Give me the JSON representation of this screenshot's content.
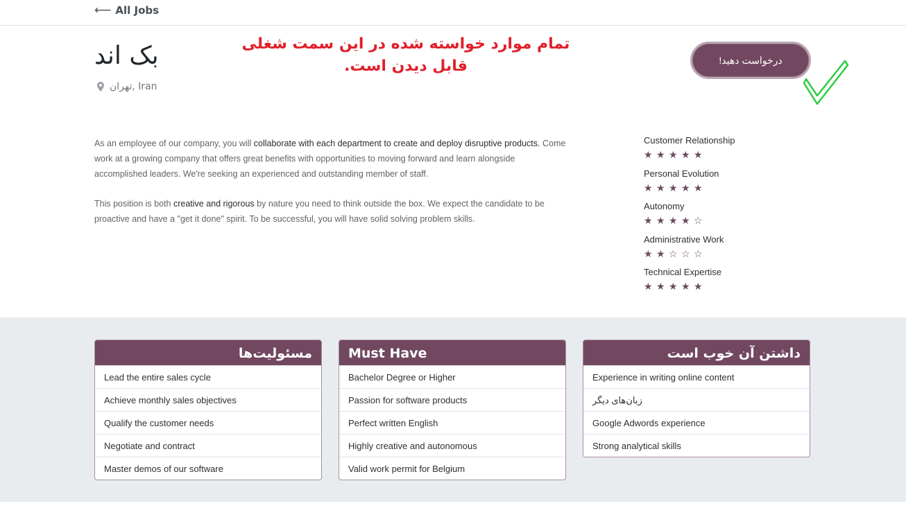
{
  "nav": {
    "back_label": "All Jobs"
  },
  "job": {
    "title": "بک اند",
    "location": "تهران, Iran"
  },
  "annotation": "تمام موارد خواسته شده در این سمت شغلی قابل دیدن است.",
  "apply_button": "درخواست دهید!",
  "description": {
    "p1": [
      {
        "text": "As an employee of our company, you will ",
        "bold": false
      },
      {
        "text": "collaborate with each department to create and deploy disruptive products.",
        "bold": true
      },
      {
        "text": " Come work at a growing company that offers great benefits with opportunities to moving forward and learn alongside accomplished leaders. We're seeking an experienced and outstanding member of staff.",
        "bold": false
      }
    ],
    "p2": [
      {
        "text": "This position is both ",
        "bold": false
      },
      {
        "text": "creative and rigorous",
        "bold": true
      },
      {
        "text": " by nature you need to think outside the box. We expect the candidate to be proactive and have a \"get it done\" spirit. To be successful, you will have solid solving problem skills.",
        "bold": false
      }
    ]
  },
  "ratings": [
    {
      "label": "Customer Relationship",
      "stars": 5,
      "max": 5
    },
    {
      "label": "Personal Evolution",
      "stars": 5,
      "max": 5
    },
    {
      "label": "Autonomy",
      "stars": 4,
      "max": 5
    },
    {
      "label": "Administrative Work",
      "stars": 2,
      "max": 5
    },
    {
      "label": "Technical Expertise",
      "stars": 5,
      "max": 5
    }
  ],
  "cards": [
    {
      "title": "مسئولیت‌ها",
      "rtl": true,
      "items": [
        "Lead the entire sales cycle",
        "Achieve monthly sales objectives",
        "Qualify the customer needs",
        "Negotiate and contract",
        "Master demos of our software"
      ]
    },
    {
      "title": "Must Have",
      "rtl": false,
      "items": [
        "Bachelor Degree or Higher",
        "Passion for software products",
        "Perfect written English",
        "Highly creative and autonomous",
        "Valid work permit for Belgium"
      ]
    },
    {
      "title": "داشتن آن خوب است",
      "rtl": true,
      "items": [
        "Experience in writing online content",
        "زبان‌های دیگر",
        "Google Adwords experience",
        "Strong analytical skills"
      ]
    }
  ],
  "colors": {
    "brand": "#71485f",
    "annotation": "#e0202a",
    "check": "#2ecc40"
  },
  "icons": {
    "back": "arrow-left-icon",
    "location": "map-marker-icon",
    "check": "checkmark-icon",
    "star_full": "star-icon",
    "star_empty": "star-outline-icon"
  }
}
